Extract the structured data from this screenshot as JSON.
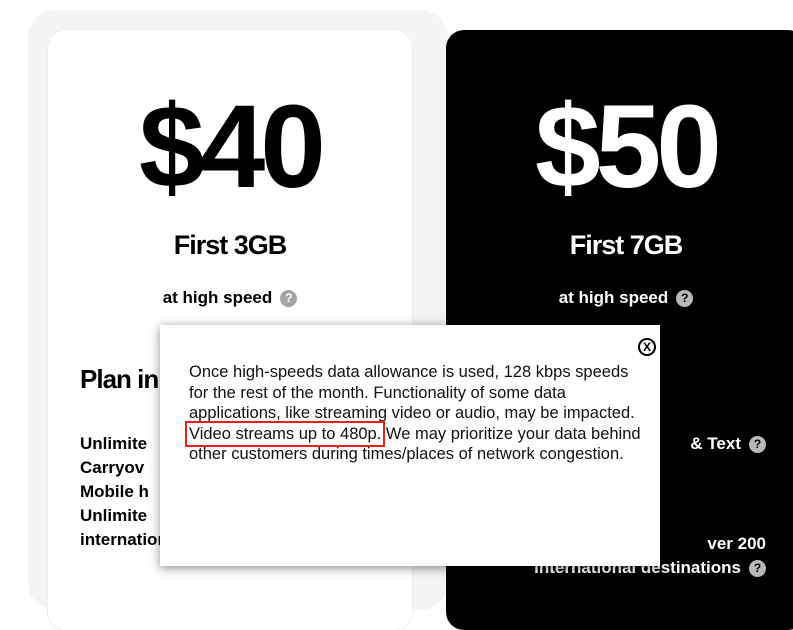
{
  "plans": [
    {
      "price": "$40",
      "data": "First 3GB",
      "speed_label": "at high speed",
      "heading": "Plan in",
      "features": [
        "Unlimite",
        "Carryov",
        "Mobile h",
        "Unlimite",
        "international destinations"
      ]
    },
    {
      "price": "$50",
      "data": "First 7GB",
      "speed_label": "at high speed",
      "talk_text": "& Text",
      "intl_line1": "ver 200",
      "intl_line2": "international destinations"
    }
  ],
  "help_icon_glyph": "?",
  "popup": {
    "close_label": "X",
    "text_before": "Once high-speeds data allowance is used, 128 kbps speeds for the rest of the month. Functionality of some data applications, like streaming video or audio, may be impacted. ",
    "text_highlight": "Video streams up to 480p.",
    "text_after": " We may prioritize your data behind other customers during times/places of network congestion.",
    "highlight_color": "#e0241b"
  }
}
